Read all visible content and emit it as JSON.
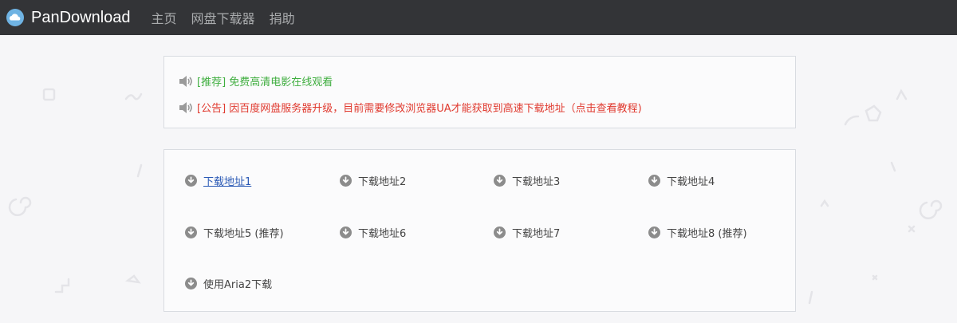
{
  "navbar": {
    "brand": "PanDownload",
    "links": [
      "主页",
      "网盘下载器",
      "捐助"
    ]
  },
  "notices": [
    {
      "text": "[推荐] 免费高清电影在线观看",
      "color": "#3fae3f"
    },
    {
      "text": "[公告] 因百度网盘服务器升级，目前需要修改浏览器UA才能获取到高速下载地址（点击查看教程)",
      "color": "#e03a2f"
    }
  ],
  "downloads": [
    {
      "label": "下载地址1"
    },
    {
      "label": "下载地址2"
    },
    {
      "label": "下载地址3"
    },
    {
      "label": "下载地址4"
    },
    {
      "label": "下载地址5 (推荐)"
    },
    {
      "label": "下载地址6"
    },
    {
      "label": "下载地址7"
    },
    {
      "label": "下载地址8 (推荐)"
    },
    {
      "label": "使用Aria2下载"
    }
  ],
  "colors": {
    "navbar_bg": "#333437",
    "link": "#2a59b5",
    "icon_gray": "#8c8c8c"
  }
}
